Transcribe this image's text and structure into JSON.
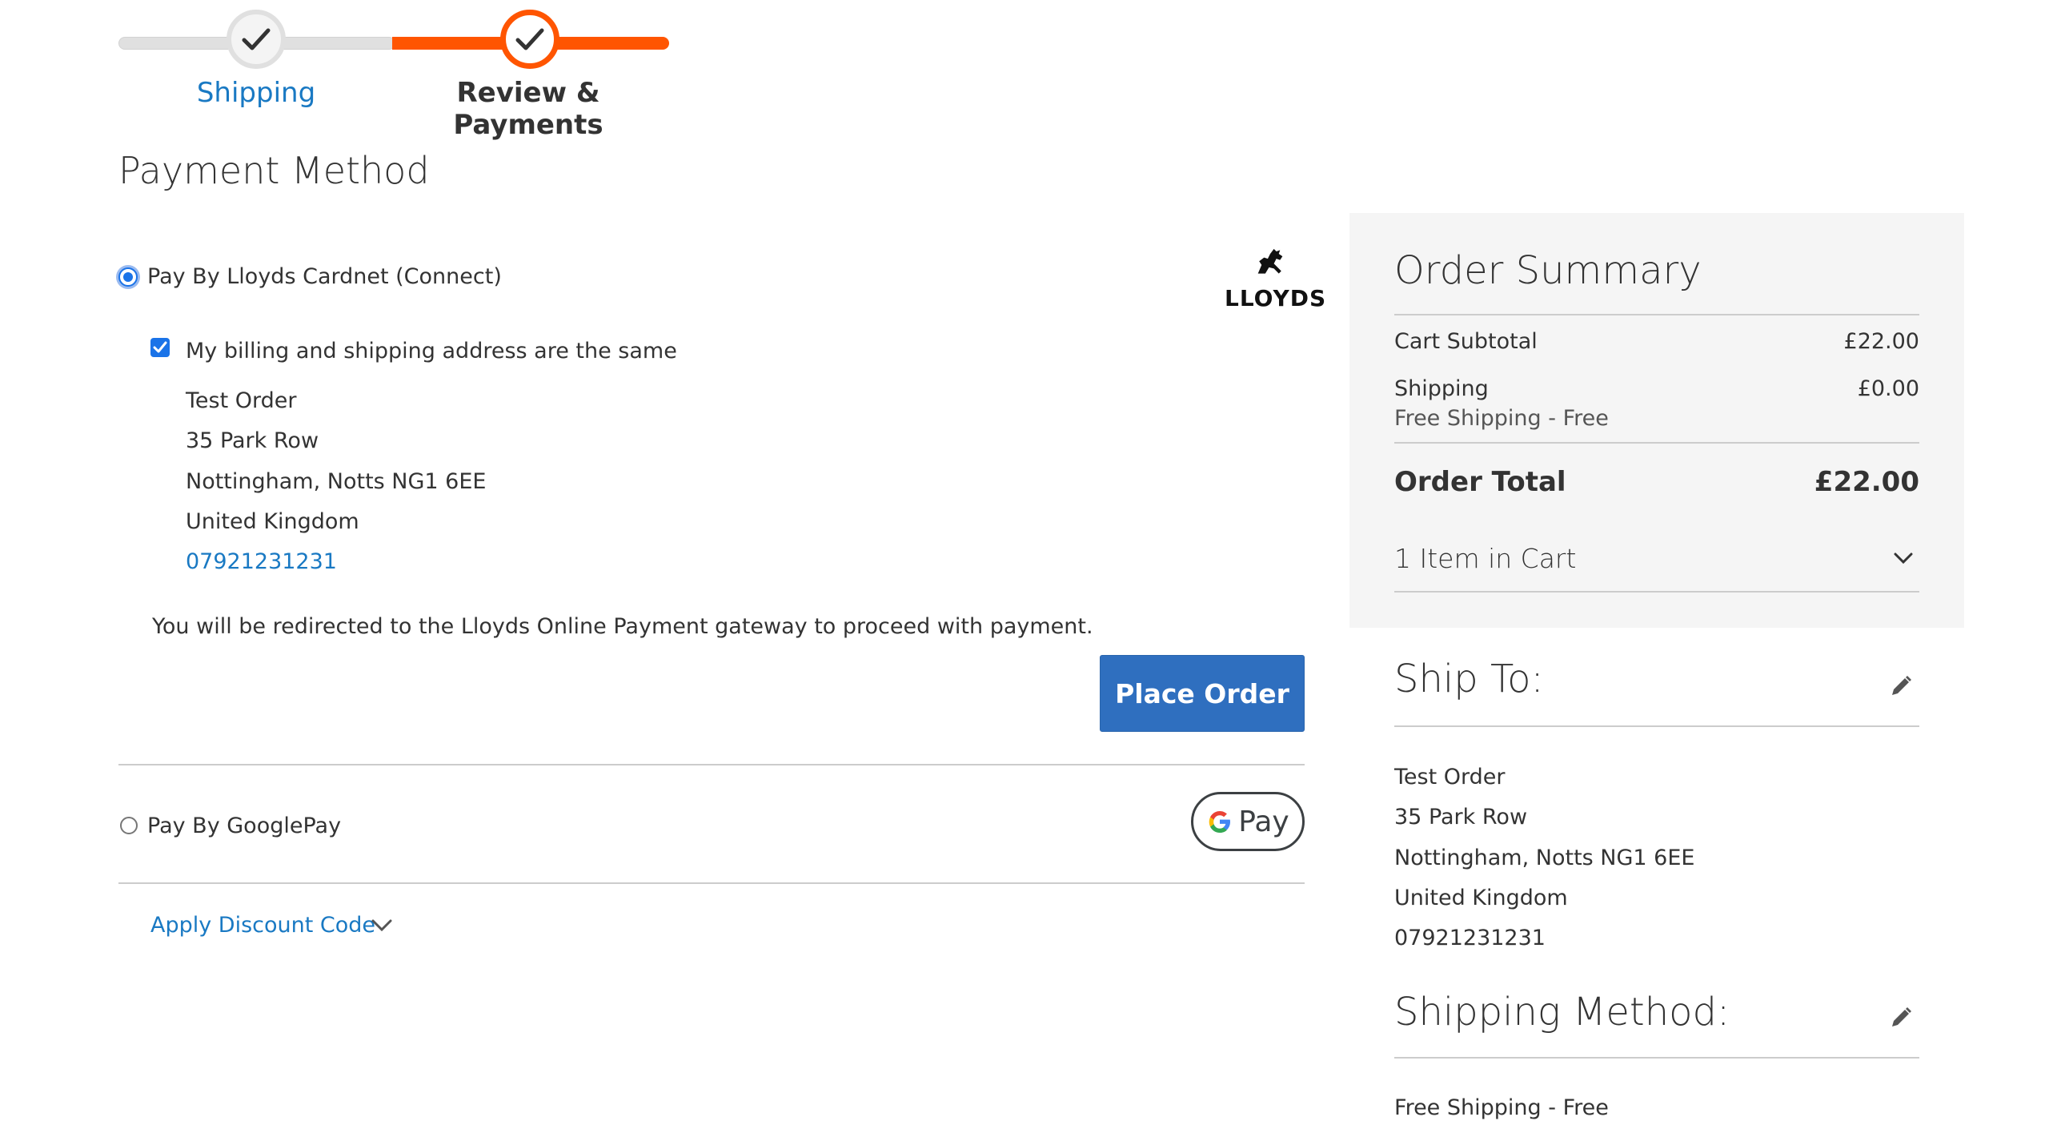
{
  "progress": {
    "steps": [
      {
        "label": "Shipping",
        "state": "complete"
      },
      {
        "label": "Review & Payments",
        "state": "active"
      }
    ]
  },
  "page_title": "Payment Method",
  "payment_methods": {
    "lloyds": {
      "label": "Pay By Lloyds Cardnet (Connect)",
      "selected": true,
      "logo_text": "LLOYDS",
      "billing_same_label": "My billing and shipping address are the same",
      "billing_same_checked": true,
      "address": {
        "name": "Test Order",
        "street": "35 Park Row",
        "city_line": "Nottingham, Notts NG1 6EE",
        "country": "United Kingdom",
        "phone": "07921231231"
      },
      "redirect_note": "You will be redirected to the Lloyds Online Payment gateway to proceed with payment.",
      "place_order_label": "Place Order"
    },
    "googlepay": {
      "label": "Pay By GooglePay",
      "selected": false,
      "badge_text": "Pay"
    }
  },
  "discount": {
    "label": "Apply Discount Code"
  },
  "order_summary": {
    "title": "Order Summary",
    "cart_subtotal_label": "Cart Subtotal",
    "cart_subtotal_value": "£22.00",
    "shipping_label": "Shipping",
    "shipping_value": "£0.00",
    "shipping_method_note": "Free Shipping - Free",
    "order_total_label": "Order Total",
    "order_total_value": "£22.00",
    "items_in_cart": "1 Item in Cart"
  },
  "ship_to": {
    "title": "Ship To:",
    "name": "Test Order",
    "street": "35 Park Row",
    "city_line": "Nottingham, Notts NG1 6EE",
    "country": "United Kingdom",
    "phone": "07921231231"
  },
  "shipping_method": {
    "title": "Shipping Method:",
    "value": "Free Shipping - Free"
  },
  "colors": {
    "accent_orange": "#ff5501",
    "link_blue": "#1979c3",
    "button_blue": "#2f6fbf",
    "summary_bg": "#f5f5f5"
  }
}
